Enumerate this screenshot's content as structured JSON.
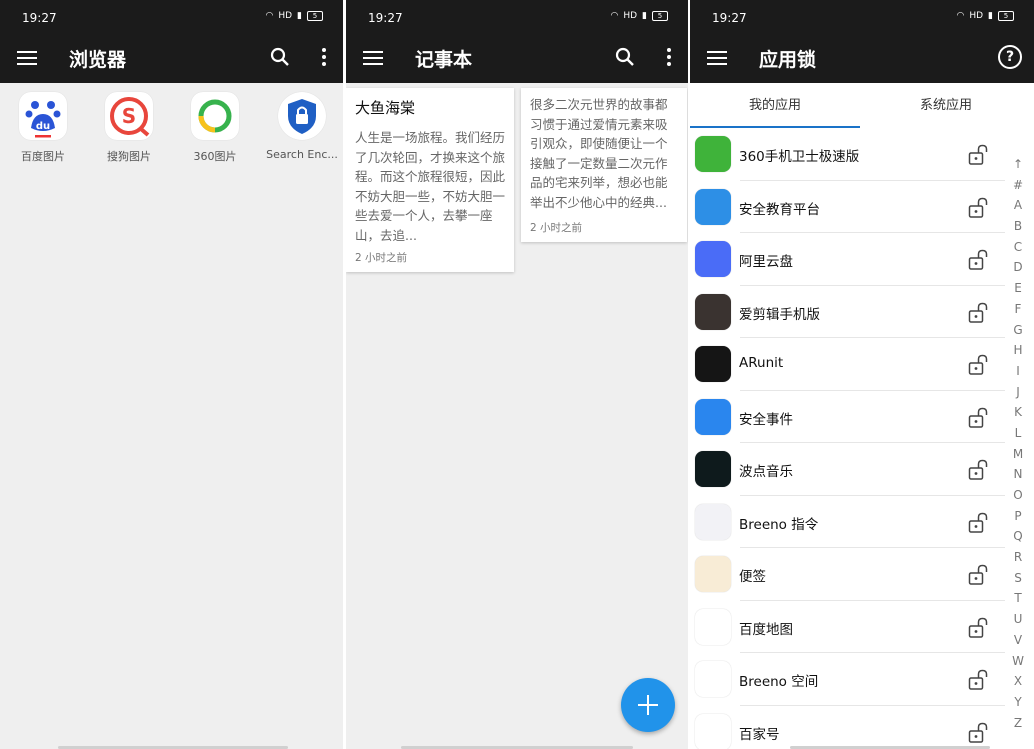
{
  "status": {
    "time": "19:27",
    "hd": "HD",
    "battery": "5"
  },
  "browser": {
    "title": "浏览器",
    "apps": [
      {
        "name": "百度图片",
        "icon": "baidu-paw-icon"
      },
      {
        "name": "搜狗图片",
        "icon": "sogou-icon"
      },
      {
        "name": "360图片",
        "icon": "360-ring-icon"
      },
      {
        "name": "Search Enc...",
        "icon": "shield-lock-icon"
      }
    ]
  },
  "notepad": {
    "title": "记事本",
    "notes": [
      {
        "title": "大鱼海棠",
        "body": "人生是一场旅程。我们经历了几次轮回，才换来这个旅程。而这个旅程很短，因此不妨大胆一些，不妨大胆一些去爱一个人，去攀一座山，去追...",
        "date": "2 小时之前"
      },
      {
        "title": "",
        "body": "很多二次元世界的故事都习惯于通过爱情元素来吸引观众，即使随便让一个接触了一定数量二次元作品的宅来列举，想必也能举出不少他心中的经典...",
        "date": "2 小时之前"
      }
    ]
  },
  "applock": {
    "title": "应用锁",
    "help": "?",
    "tabs": [
      "我的应用",
      "系统应用"
    ],
    "apps": [
      {
        "name": "360手机卫士极速版",
        "color": "#3fb33a"
      },
      {
        "name": "安全教育平台",
        "color": "#2d8fe6"
      },
      {
        "name": "阿里云盘",
        "color": "#4a6cf7"
      },
      {
        "name": "爱剪辑手机版",
        "color": "#3a3330"
      },
      {
        "name": "ARunit",
        "color": "#151515"
      },
      {
        "name": "安全事件",
        "color": "#2a86ee"
      },
      {
        "name": "波点音乐",
        "color": "#0e1a1c"
      },
      {
        "name": "Breeno 指令",
        "color": "#f2f2f6"
      },
      {
        "name": "便签",
        "color": "#f8ecd6"
      },
      {
        "name": "百度地图",
        "color": "#ffffff"
      },
      {
        "name": "Breeno 空间",
        "color": "#ffffff"
      },
      {
        "name": "百家号",
        "color": "#ffffff"
      }
    ],
    "index": [
      "↑",
      "#",
      "A",
      "B",
      "C",
      "D",
      "E",
      "F",
      "G",
      "H",
      "I",
      "J",
      "K",
      "L",
      "M",
      "N",
      "O",
      "P",
      "Q",
      "R",
      "S",
      "T",
      "U",
      "V",
      "W",
      "X",
      "Y",
      "Z"
    ]
  }
}
